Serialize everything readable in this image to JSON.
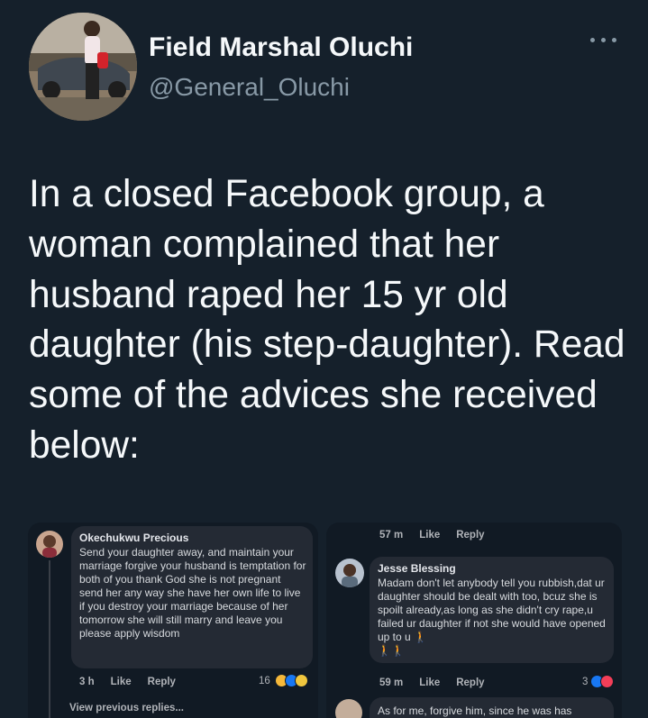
{
  "tweet": {
    "author_name": "Field Marshal Oluchi",
    "author_handle": "@General_Oluchi",
    "text": "In a closed Facebook group, a woman complained that her husband raped her 15 yr old daughter (his step-daughter). Read some of the advices she received below:"
  },
  "left_comment": {
    "name": "Okechukwu Precious",
    "text": "Send your daughter away, and maintain your marriage forgive your husband is temptation for both of you thank God she is not pregnant send her any way she have her own life to live if you destroy your marriage because of her tomorrow she will still marry and leave you please apply wisdom",
    "time": "3 h",
    "like": "Like",
    "reply": "Reply",
    "reaction_count": "16",
    "view_previous": "View previous replies..."
  },
  "right_top_meta": {
    "time": "57 m",
    "like": "Like",
    "reply": "Reply"
  },
  "right_comment": {
    "name": "Jesse Blessing",
    "text": "Madam don't let anybody tell you rubbish,dat ur daughter should be dealt with too, bcuz she is spoilt already,as long as she didn't cry rape,u failed ur daughter if not she would have opened up to u",
    "time": "59 m",
    "like": "Like",
    "reply": "Reply",
    "reaction_count": "3"
  },
  "right_next_comment": {
    "text": "As for me, forgive him, since he was has"
  },
  "icons": [
    "more-icon",
    "haha-reaction-icon",
    "like-reaction-icon",
    "love-reaction-icon",
    "walking-person-emoji"
  ],
  "colors": {
    "background": "#15202b",
    "text_primary": "#f5f8fa",
    "text_secondary": "#8899a6",
    "fb_bubble": "#242a34",
    "like_blue": "#1877f2",
    "love_red": "#f33e58"
  }
}
